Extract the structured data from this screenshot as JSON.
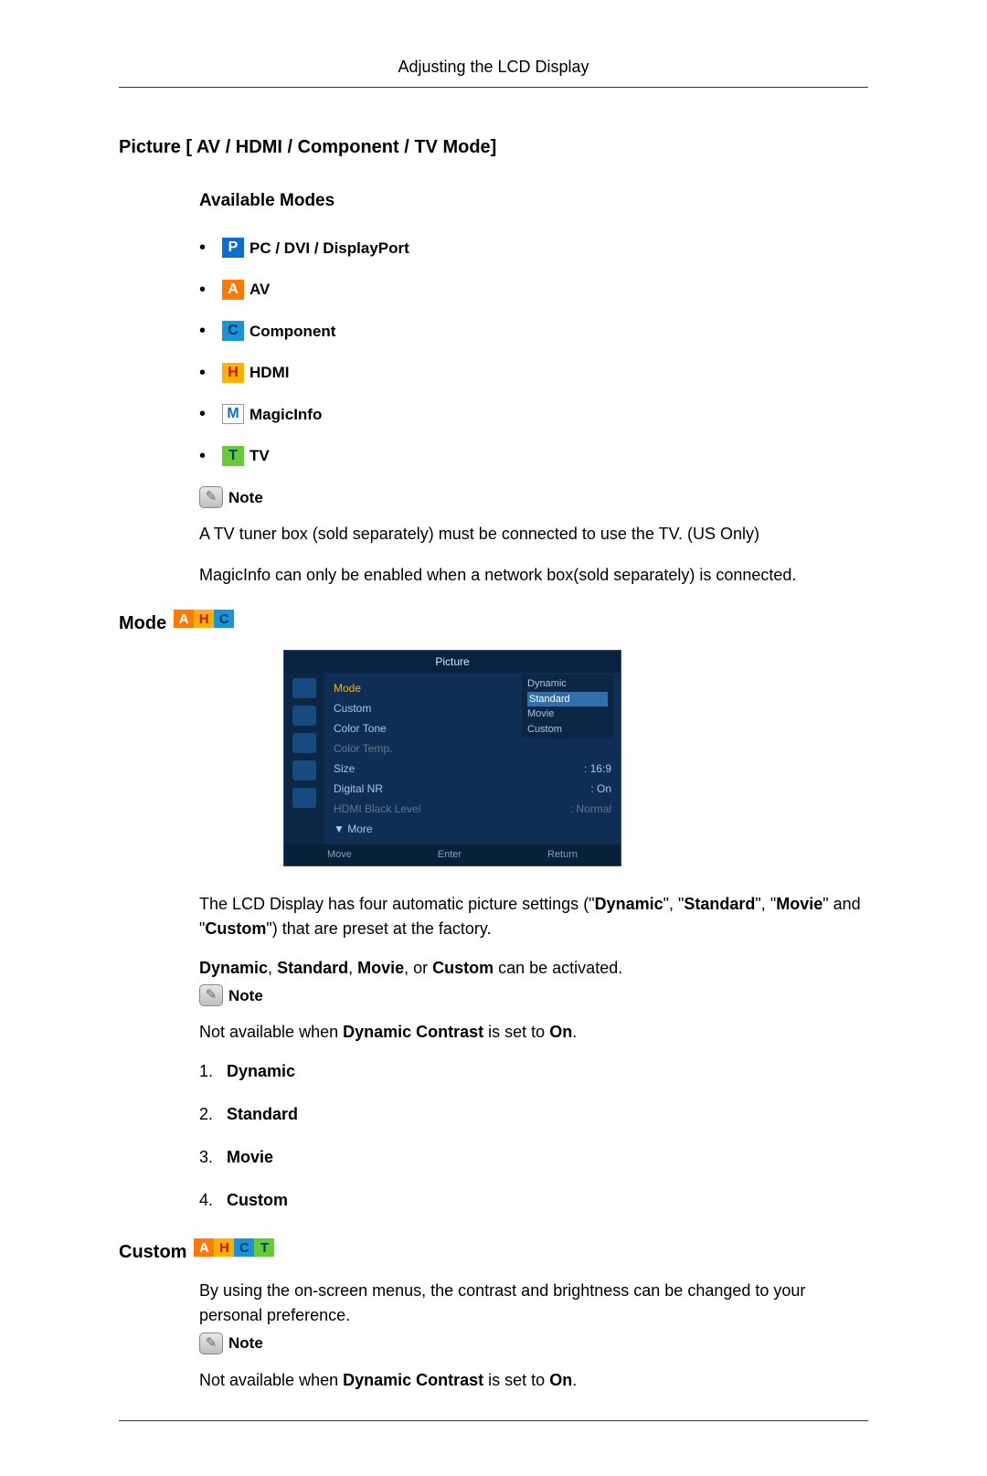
{
  "header": {
    "title": "Adjusting the LCD Display"
  },
  "picture_section": {
    "title": "Picture [ AV / HDMI / Component / TV Mode]",
    "available_modes_heading": "Available Modes",
    "modes": [
      {
        "letter": "P",
        "label": "PC / DVI / DisplayPort"
      },
      {
        "letter": "A",
        "label": "AV"
      },
      {
        "letter": "C",
        "label": "Component"
      },
      {
        "letter": "H",
        "label": "HDMI"
      },
      {
        "letter": "M",
        "label": "MagicInfo"
      },
      {
        "letter": "T",
        "label": "TV"
      }
    ],
    "note_label": "Note",
    "note_body1": "A TV tuner box (sold separately) must be connected to use the TV. (US Only)",
    "note_body2": "MagicInfo can only be enabled when a network box(sold separately) is connected."
  },
  "mode_section": {
    "heading": "Mode",
    "badges": [
      "A",
      "H",
      "C"
    ],
    "osd": {
      "title": "Picture",
      "rows": [
        {
          "label": "Mode",
          "value": "",
          "hl_left": true
        },
        {
          "label": "Custom",
          "value": ""
        },
        {
          "label": "Color Tone",
          "value": ":"
        },
        {
          "label": "Color Temp.",
          "value": "",
          "dim": true
        },
        {
          "label": "Size",
          "value": ": 16:9"
        },
        {
          "label": "Digital NR",
          "value": ": On"
        },
        {
          "label": "HDMI Black Level",
          "value": ": Normal",
          "dim": true
        },
        {
          "label": "▼ More",
          "value": ""
        }
      ],
      "dropdown": [
        "Dynamic",
        "Standard",
        "Movie",
        "Custom"
      ],
      "dropdown_selected": "Standard",
      "footer": [
        "Move",
        "Enter",
        "Return"
      ]
    },
    "para1_prefix": "The LCD Display has four automatic picture settings (\"",
    "para1_b1": "Dynamic",
    "para1_mid1": "\", \"",
    "para1_b2": "Standard",
    "para1_mid2": "\", \"",
    "para1_b3": "Movie",
    "para1_mid3": "\" and \"",
    "para1_b4": "Custom",
    "para1_suffix": "\") that are preset at the factory.",
    "para2_b1": "Dynamic",
    "para2_c1": ", ",
    "para2_b2": "Standard",
    "para2_c2": ", ",
    "para2_b3": "Movie",
    "para2_c3": ", or ",
    "para2_b4": "Custom",
    "para2_suffix": " can be activated.",
    "note_label": "Note",
    "note_body_prefix": "Not available when ",
    "note_body_b1": "Dynamic Contrast",
    "note_body_mid": " is set to ",
    "note_body_b2": "On",
    "note_body_suffix": ".",
    "list": [
      "Dynamic",
      "Standard",
      "Movie",
      "Custom"
    ]
  },
  "custom_section": {
    "heading": "Custom",
    "badges": [
      "A",
      "H",
      "C",
      "T"
    ],
    "body": "By using the on-screen menus, the contrast and brightness can be changed to your personal preference.",
    "note_label": "Note",
    "note_body_prefix": "Not available when ",
    "note_body_b1": "Dynamic Contrast",
    "note_body_mid": " is set to ",
    "note_body_b2": "On",
    "note_body_suffix": "."
  }
}
